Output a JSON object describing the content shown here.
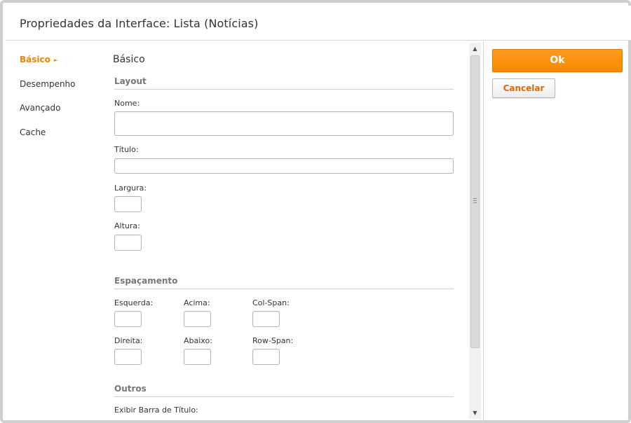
{
  "dialog": {
    "title": "Propriedades da Interface: Lista (Notícias)"
  },
  "nav": {
    "items": [
      {
        "label": "Básico",
        "active": true
      },
      {
        "label": "Desempenho",
        "active": false
      },
      {
        "label": "Avançado",
        "active": false
      },
      {
        "label": "Cache",
        "active": false
      }
    ],
    "active_marker": "►"
  },
  "form": {
    "section_title": "Básico",
    "layout": {
      "title": "Layout",
      "name_label": "Nome:",
      "name_value": "",
      "title_label": "Título:",
      "title_value": "",
      "width_label": "Largura:",
      "width_value": "",
      "height_label": "Altura:",
      "height_value": ""
    },
    "spacing": {
      "title": "Espaçamento",
      "left_label": "Esquerda:",
      "left_value": "",
      "top_label": "Acima:",
      "top_value": "",
      "colspan_label": "Col-Span:",
      "colspan_value": "",
      "right_label": "Direita:",
      "right_value": "",
      "bottom_label": "Abaixo:",
      "bottom_value": "",
      "rowspan_label": "Row-Span:",
      "rowspan_value": ""
    },
    "others": {
      "title": "Outros",
      "show_titlebar_label": "Exibir Barra de Título:"
    }
  },
  "actions": {
    "ok_label": "Ok",
    "cancel_label": "Cancelar"
  },
  "colors": {
    "accent": "#f78a00",
    "cancel_text": "#e06a00"
  },
  "icons": {
    "scroll_up": "▲",
    "scroll_down": "▼"
  }
}
